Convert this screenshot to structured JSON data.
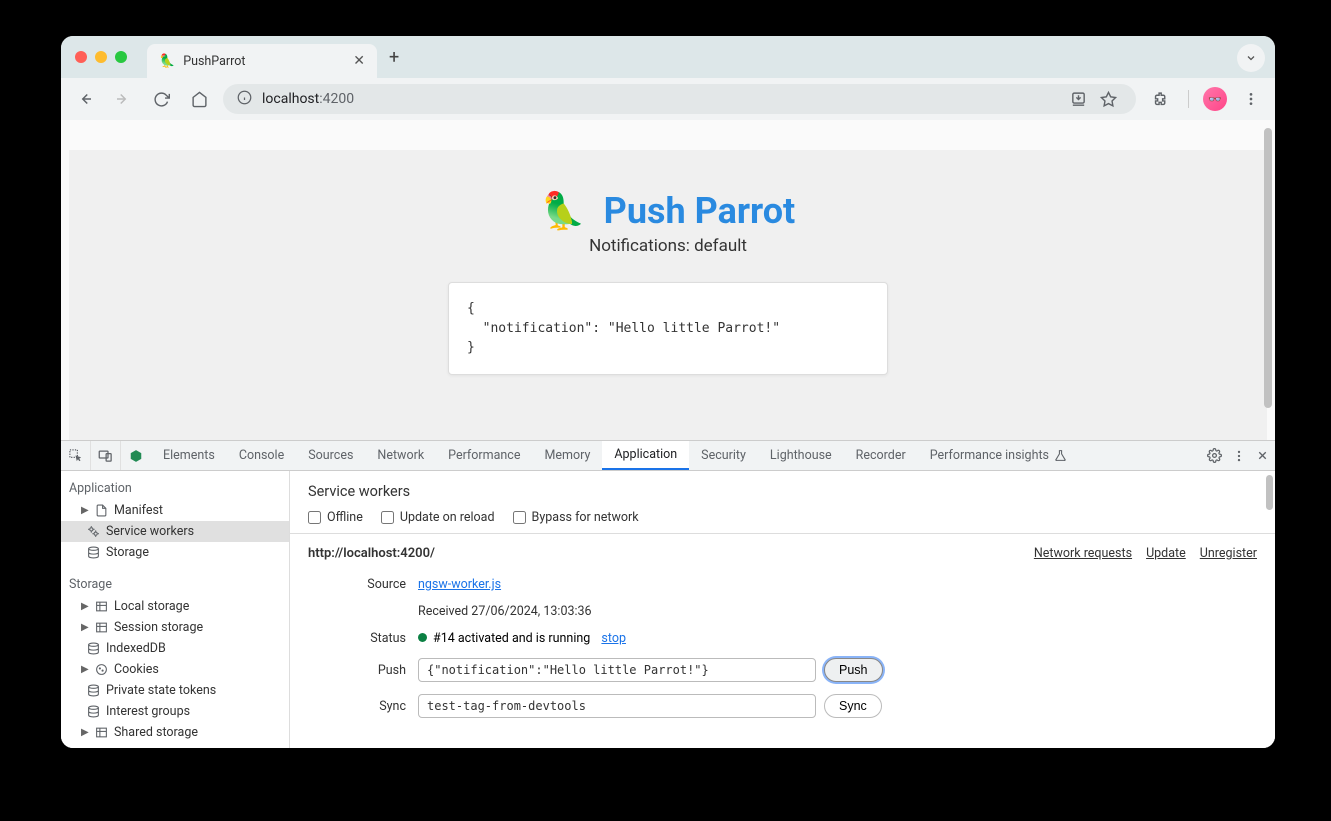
{
  "browser": {
    "tab": {
      "title": "PushParrot",
      "favicon": "🦜"
    },
    "url": {
      "host": "localhost",
      "port": ":4200"
    }
  },
  "page": {
    "logo": "🦜",
    "title": "Push Parrot",
    "subtitle": "Notifications: default",
    "json_snippet": "{\n  \"notification\": \"Hello little Parrot!\"\n}"
  },
  "devtools": {
    "tabs": [
      "Elements",
      "Console",
      "Sources",
      "Network",
      "Performance",
      "Memory",
      "Application",
      "Security",
      "Lighthouse",
      "Recorder",
      "Performance insights"
    ],
    "active_tab": "Application",
    "sidebar": {
      "groups": [
        {
          "label": "Application",
          "items": [
            {
              "label": "Manifest",
              "expandable": true
            },
            {
              "label": "Service workers",
              "active": true
            },
            {
              "label": "Storage"
            }
          ]
        },
        {
          "label": "Storage",
          "items": [
            {
              "label": "Local storage",
              "expandable": true
            },
            {
              "label": "Session storage",
              "expandable": true
            },
            {
              "label": "IndexedDB"
            },
            {
              "label": "Cookies",
              "expandable": true
            },
            {
              "label": "Private state tokens"
            },
            {
              "label": "Interest groups"
            },
            {
              "label": "Shared storage",
              "expandable": true
            }
          ]
        }
      ]
    },
    "sw_panel": {
      "heading": "Service workers",
      "checks": {
        "offline": "Offline",
        "update": "Update on reload",
        "bypass": "Bypass for network"
      },
      "origin": "http://localhost:4200/",
      "links": {
        "nr": "Network requests",
        "upd": "Update",
        "unreg": "Unregister"
      },
      "rows": {
        "source_label": "Source",
        "source_file": "ngsw-worker.js",
        "received": "Received 27/06/2024, 13:03:36",
        "status_label": "Status",
        "status_text": "#14 activated and is running",
        "stop": "stop",
        "push_label": "Push",
        "push_value": "{\"notification\":\"Hello little Parrot!\"}",
        "push_btn": "Push",
        "sync_label": "Sync",
        "sync_value": "test-tag-from-devtools",
        "sync_btn": "Sync"
      }
    }
  }
}
